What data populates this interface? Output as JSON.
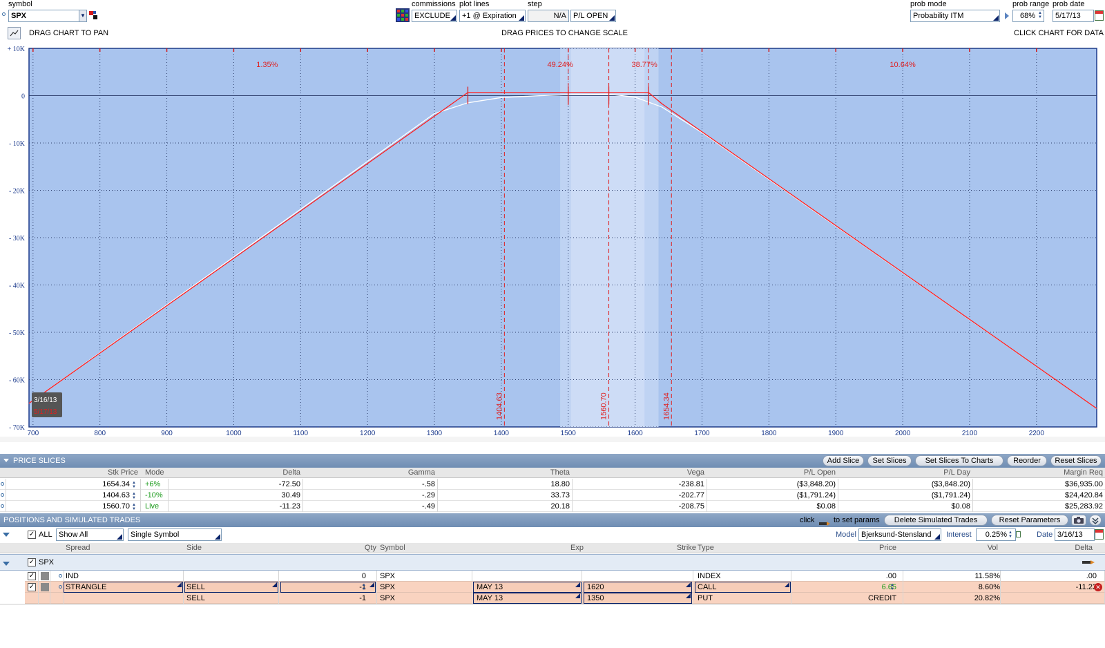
{
  "toolbar": {
    "symbol_label": "symbol",
    "symbol_value": "SPX",
    "commissions_label": "commissions",
    "commissions_value": "EXCLUDE",
    "plotlines_label": "plot lines",
    "plotlines_value": "+1 @ Expiration",
    "step_label": "step",
    "step_value": "N/A",
    "pl_value": "P/L OPEN",
    "probmode_label": "prob mode",
    "probmode_value": "Probability ITM",
    "probrange_label": "prob range",
    "probrange_value": "68%",
    "probdate_label": "prob date",
    "probdate_value": "5/17/13"
  },
  "chart_header": {
    "drag_pan": "DRAG CHART TO PAN",
    "drag_prices": "DRAG PRICES TO CHANGE SCALE",
    "click_chart": "CLICK CHART FOR DATA"
  },
  "chart_data": {
    "type": "line",
    "x_ticks": [
      "700",
      "800",
      "900",
      "1000",
      "1100",
      "1200",
      "1300",
      "1400",
      "1500",
      "1600",
      "1700",
      "1800",
      "1900",
      "2000",
      "2100",
      "2200"
    ],
    "y_ticks": [
      "+ 10K",
      "0",
      "- 10K",
      "- 20K",
      "- 30K",
      "- 40K",
      "- 50K",
      "- 60K",
      "- 70K"
    ],
    "xlim": [
      694,
      2290
    ],
    "ylim": [
      -70000,
      10000
    ],
    "prob_labels": [
      {
        "text": "1.35%",
        "x": 1050
      },
      {
        "text": "49.24%",
        "x": 1488
      },
      {
        "text": "38.77%",
        "x": 1614
      },
      {
        "text": "10.64%",
        "x": 2000
      }
    ],
    "price_lines": [
      {
        "label": "1404.63",
        "x": 1404.63
      },
      {
        "label": "1560.70",
        "x": 1560.7
      },
      {
        "label": "1654.34",
        "x": 1654.34
      }
    ],
    "marker_lines": [
      1500,
      1560.7,
      1620
    ],
    "prob_band": [
      1488,
      1635
    ],
    "inner_band": [
      1504,
      1614
    ],
    "series": [
      {
        "color": "#ff2020",
        "points": [
          [
            694,
            -65000
          ],
          [
            1350,
            665
          ],
          [
            1620,
            665
          ],
          [
            1640,
            -1700
          ],
          [
            2290,
            -66100
          ]
        ]
      },
      {
        "color": "#ffffff",
        "points": [
          [
            694,
            -65000
          ],
          [
            1300,
            -3800
          ],
          [
            1350,
            -1500
          ],
          [
            1400,
            -400
          ],
          [
            1450,
            -60
          ],
          [
            1500,
            200
          ],
          [
            1560,
            300
          ],
          [
            1600,
            -300
          ],
          [
            1640,
            -2400
          ],
          [
            1700,
            -7800
          ],
          [
            2290,
            -66100
          ]
        ]
      }
    ],
    "date_badge_top": "3/16/13",
    "date_badge_bottom": "5/17/13"
  },
  "price_slices": {
    "title": "PRICE SLICES",
    "buttons": [
      "Add Slice",
      "Set Slices",
      "Set Slices To Charts",
      "Reorder",
      "Reset Slices"
    ],
    "columns": [
      "Stk Price",
      "Mode",
      "Delta",
      "Gamma",
      "Theta",
      "Vega",
      "P/L Open",
      "P/L Day",
      "Margin Req"
    ],
    "rows": [
      {
        "price": "1654.34",
        "mode": "+6%",
        "delta": "-72.50",
        "gamma": "-.58",
        "theta": "18.80",
        "vega": "-238.81",
        "pl_open": "($3,848.20)",
        "pl_day": "($3,848.20)",
        "margin": "$36,935.00"
      },
      {
        "price": "1404.63",
        "mode": "-10%",
        "delta": "30.49",
        "gamma": "-.29",
        "theta": "33.73",
        "vega": "-202.77",
        "pl_open": "($1,791.24)",
        "pl_day": "($1,791.24)",
        "margin": "$24,420.84"
      },
      {
        "price": "1560.70",
        "mode": "Live",
        "delta": "-11.23",
        "gamma": "-.49",
        "theta": "20.18",
        "vega": "-208.75",
        "pl_open": "$0.08",
        "pl_day": "$0.08",
        "margin": "$25,283.92"
      }
    ]
  },
  "positions": {
    "title": "POSITIONS AND SIMULATED TRADES",
    "click_text": "click",
    "set_params_text": "to set params",
    "buttons": [
      "Delete Simulated Trades",
      "Reset Parameters"
    ],
    "all_label": "ALL",
    "show_value": "Show All",
    "single_value": "Single Symbol",
    "model_label": "Model",
    "model_value": "Bjerksund-Stensland",
    "interest_label": "Interest",
    "interest_value": "0.25%",
    "date_label": "Date",
    "date_value": "3/16/13",
    "columns": [
      "Spread",
      "Side",
      "Qty",
      "Symbol",
      "Exp",
      "Strike",
      "Type",
      "Price",
      "Vol",
      "Delta"
    ],
    "group": "SPX",
    "rows": [
      {
        "spread": "IND",
        "side": "",
        "qty": "0",
        "symbol": "SPX",
        "exp": "",
        "strike": "",
        "type": "INDEX",
        "price": ".00",
        "vol": "11.58%",
        "delta": ".00"
      },
      {
        "spread": "STRANGLE",
        "side": "SELL",
        "qty": "-1",
        "symbol": "SPX",
        "exp": "MAY 13",
        "strike": "1620",
        "type": "CALL",
        "price": "6.65",
        "vol": "8.60%",
        "delta": "-11.23"
      },
      {
        "spread": "",
        "side": "SELL",
        "qty": "-1",
        "symbol": "SPX",
        "exp": "MAY 13",
        "strike": "1350",
        "type": "PUT",
        "price": "CREDIT",
        "vol": "20.82%",
        "delta": ""
      }
    ]
  }
}
